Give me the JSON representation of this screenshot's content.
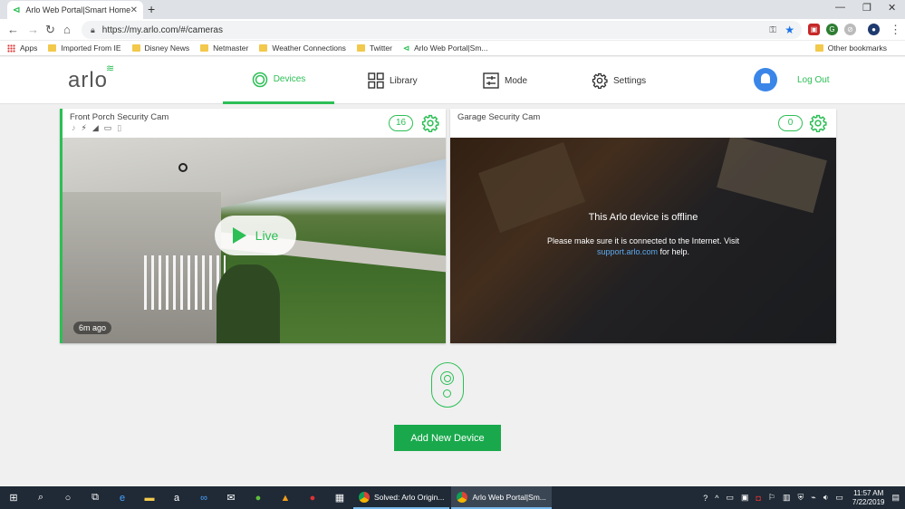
{
  "browser": {
    "tab_title": "Arlo Web Portal|Smart Home Se",
    "tab_close": "✕",
    "new_tab": "+",
    "url": "https://my.arlo.com/#/cameras",
    "bookmarks": [
      {
        "label": "Apps",
        "kind": "apps"
      },
      {
        "label": "Imported From IE",
        "kind": "folder"
      },
      {
        "label": "Disney News",
        "kind": "folder"
      },
      {
        "label": "Netmaster",
        "kind": "folder"
      },
      {
        "label": "Weather Connections",
        "kind": "folder"
      },
      {
        "label": "Twitter",
        "kind": "folder"
      },
      {
        "label": "Arlo Web Portal|Sm...",
        "kind": "arlo"
      }
    ],
    "other_bookmarks": "Other bookmarks"
  },
  "header": {
    "logo": "arlo",
    "nav": {
      "devices": "Devices",
      "library": "Library",
      "mode": "Mode",
      "settings": "Settings"
    },
    "logout": "Log Out"
  },
  "cameras": [
    {
      "name": "Front Porch Security Cam",
      "count": "16",
      "time_ago": "6m ago",
      "live_label": "Live"
    },
    {
      "name": "Garage Security Cam",
      "count": "0",
      "offline_title": "This Arlo device is offline",
      "offline_msg_1": "Please make sure it is connected to the Internet. Visit",
      "offline_link": "support.arlo.com",
      "offline_msg_2": " for help."
    }
  ],
  "add_device_label": "Add New Device",
  "taskbar": {
    "apps": [
      {
        "label": "Solved: Arlo Origin..."
      },
      {
        "label": "Arlo Web Portal|Sm..."
      }
    ],
    "time": "11:57 AM",
    "date": "7/22/2019"
  },
  "colors": {
    "accent": "#2cbf55",
    "button": "#19a94c",
    "bell": "#3a86e8",
    "link": "#5aa9ef"
  }
}
